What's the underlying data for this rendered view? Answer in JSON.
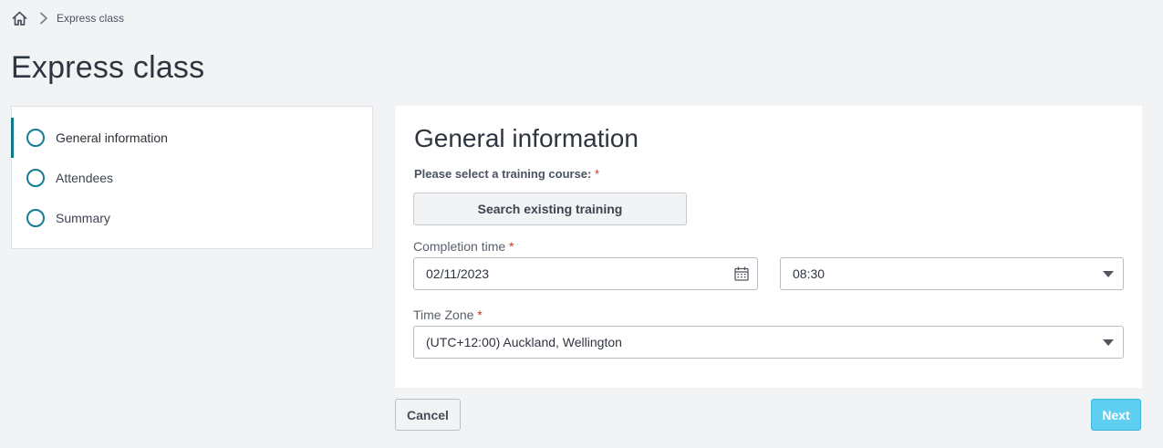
{
  "breadcrumb": {
    "home_icon": "home-icon",
    "separator_icon": "chevron-right-icon",
    "current": "Express class"
  },
  "page_title": "Express class",
  "steps": [
    {
      "label": "General information",
      "active": true
    },
    {
      "label": "Attendees",
      "active": false
    },
    {
      "label": "Summary",
      "active": false
    }
  ],
  "form": {
    "title": "General information",
    "course_label": "Please select a training course:",
    "required_mark": "*",
    "search_button": "Search existing training",
    "completion_time_label": "Completion time",
    "date_value": "02/11/2023",
    "time_value": "08:30",
    "time_zone_label": "Time Zone",
    "time_zone_value": "(UTC+12:00) Auckland, Wellington"
  },
  "actions": {
    "cancel": "Cancel",
    "next": "Next"
  },
  "colors": {
    "accent": "#137d8f",
    "next_button": "#5fcff0",
    "required": "#c0392b"
  }
}
